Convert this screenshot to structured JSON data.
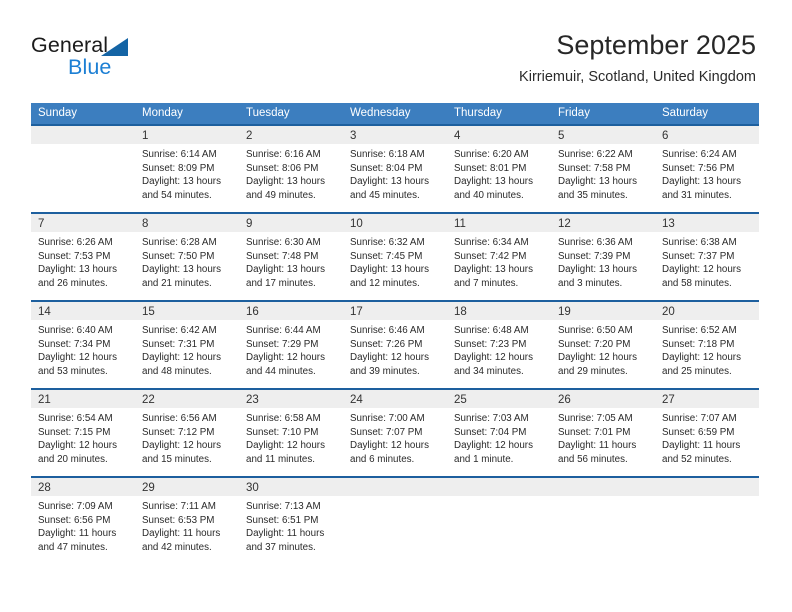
{
  "brand": {
    "name_line1": "General",
    "name_line2": "Blue",
    "triangle_icon": "blue-triangle-logo-mark",
    "color_dark": "#1b1b1b",
    "color_blue": "#1c7fd4",
    "triangle_color": "#1464a5"
  },
  "header": {
    "title": "September 2025",
    "subtitle": "Kirriemuir, Scotland, United Kingdom"
  },
  "theme": {
    "header_row_bg": "#3c7ebf",
    "week_rule": "#1d5f9e",
    "daynum_band_bg": "#eeeeee",
    "text": "#2a2a2a"
  },
  "columns": [
    "Sunday",
    "Monday",
    "Tuesday",
    "Wednesday",
    "Thursday",
    "Friday",
    "Saturday"
  ],
  "labels": {
    "sunrise_prefix": "Sunrise:",
    "sunset_prefix": "Sunset:",
    "daylight_prefix": "Daylight:"
  },
  "weeks": [
    [
      {
        "day": "",
        "empty": true,
        "lines": []
      },
      {
        "day": "1",
        "lines": [
          "Sunrise: 6:14 AM",
          "Sunset: 8:09 PM",
          "Daylight: 13 hours",
          "and 54 minutes."
        ]
      },
      {
        "day": "2",
        "lines": [
          "Sunrise: 6:16 AM",
          "Sunset: 8:06 PM",
          "Daylight: 13 hours",
          "and 49 minutes."
        ]
      },
      {
        "day": "3",
        "lines": [
          "Sunrise: 6:18 AM",
          "Sunset: 8:04 PM",
          "Daylight: 13 hours",
          "and 45 minutes."
        ]
      },
      {
        "day": "4",
        "lines": [
          "Sunrise: 6:20 AM",
          "Sunset: 8:01 PM",
          "Daylight: 13 hours",
          "and 40 minutes."
        ]
      },
      {
        "day": "5",
        "lines": [
          "Sunrise: 6:22 AM",
          "Sunset: 7:58 PM",
          "Daylight: 13 hours",
          "and 35 minutes."
        ]
      },
      {
        "day": "6",
        "lines": [
          "Sunrise: 6:24 AM",
          "Sunset: 7:56 PM",
          "Daylight: 13 hours",
          "and 31 minutes."
        ]
      }
    ],
    [
      {
        "day": "7",
        "lines": [
          "Sunrise: 6:26 AM",
          "Sunset: 7:53 PM",
          "Daylight: 13 hours",
          "and 26 minutes."
        ]
      },
      {
        "day": "8",
        "lines": [
          "Sunrise: 6:28 AM",
          "Sunset: 7:50 PM",
          "Daylight: 13 hours",
          "and 21 minutes."
        ]
      },
      {
        "day": "9",
        "lines": [
          "Sunrise: 6:30 AM",
          "Sunset: 7:48 PM",
          "Daylight: 13 hours",
          "and 17 minutes."
        ]
      },
      {
        "day": "10",
        "lines": [
          "Sunrise: 6:32 AM",
          "Sunset: 7:45 PM",
          "Daylight: 13 hours",
          "and 12 minutes."
        ]
      },
      {
        "day": "11",
        "lines": [
          "Sunrise: 6:34 AM",
          "Sunset: 7:42 PM",
          "Daylight: 13 hours",
          "and 7 minutes."
        ]
      },
      {
        "day": "12",
        "lines": [
          "Sunrise: 6:36 AM",
          "Sunset: 7:39 PM",
          "Daylight: 13 hours",
          "and 3 minutes."
        ]
      },
      {
        "day": "13",
        "lines": [
          "Sunrise: 6:38 AM",
          "Sunset: 7:37 PM",
          "Daylight: 12 hours",
          "and 58 minutes."
        ]
      }
    ],
    [
      {
        "day": "14",
        "lines": [
          "Sunrise: 6:40 AM",
          "Sunset: 7:34 PM",
          "Daylight: 12 hours",
          "and 53 minutes."
        ]
      },
      {
        "day": "15",
        "lines": [
          "Sunrise: 6:42 AM",
          "Sunset: 7:31 PM",
          "Daylight: 12 hours",
          "and 48 minutes."
        ]
      },
      {
        "day": "16",
        "lines": [
          "Sunrise: 6:44 AM",
          "Sunset: 7:29 PM",
          "Daylight: 12 hours",
          "and 44 minutes."
        ]
      },
      {
        "day": "17",
        "lines": [
          "Sunrise: 6:46 AM",
          "Sunset: 7:26 PM",
          "Daylight: 12 hours",
          "and 39 minutes."
        ]
      },
      {
        "day": "18",
        "lines": [
          "Sunrise: 6:48 AM",
          "Sunset: 7:23 PM",
          "Daylight: 12 hours",
          "and 34 minutes."
        ]
      },
      {
        "day": "19",
        "lines": [
          "Sunrise: 6:50 AM",
          "Sunset: 7:20 PM",
          "Daylight: 12 hours",
          "and 29 minutes."
        ]
      },
      {
        "day": "20",
        "lines": [
          "Sunrise: 6:52 AM",
          "Sunset: 7:18 PM",
          "Daylight: 12 hours",
          "and 25 minutes."
        ]
      }
    ],
    [
      {
        "day": "21",
        "lines": [
          "Sunrise: 6:54 AM",
          "Sunset: 7:15 PM",
          "Daylight: 12 hours",
          "and 20 minutes."
        ]
      },
      {
        "day": "22",
        "lines": [
          "Sunrise: 6:56 AM",
          "Sunset: 7:12 PM",
          "Daylight: 12 hours",
          "and 15 minutes."
        ]
      },
      {
        "day": "23",
        "lines": [
          "Sunrise: 6:58 AM",
          "Sunset: 7:10 PM",
          "Daylight: 12 hours",
          "and 11 minutes."
        ]
      },
      {
        "day": "24",
        "lines": [
          "Sunrise: 7:00 AM",
          "Sunset: 7:07 PM",
          "Daylight: 12 hours",
          "and 6 minutes."
        ]
      },
      {
        "day": "25",
        "lines": [
          "Sunrise: 7:03 AM",
          "Sunset: 7:04 PM",
          "Daylight: 12 hours",
          "and 1 minute."
        ]
      },
      {
        "day": "26",
        "lines": [
          "Sunrise: 7:05 AM",
          "Sunset: 7:01 PM",
          "Daylight: 11 hours",
          "and 56 minutes."
        ]
      },
      {
        "day": "27",
        "lines": [
          "Sunrise: 7:07 AM",
          "Sunset: 6:59 PM",
          "Daylight: 11 hours",
          "and 52 minutes."
        ]
      }
    ],
    [
      {
        "day": "28",
        "lines": [
          "Sunrise: 7:09 AM",
          "Sunset: 6:56 PM",
          "Daylight: 11 hours",
          "and 47 minutes."
        ]
      },
      {
        "day": "29",
        "lines": [
          "Sunrise: 7:11 AM",
          "Sunset: 6:53 PM",
          "Daylight: 11 hours",
          "and 42 minutes."
        ]
      },
      {
        "day": "30",
        "lines": [
          "Sunrise: 7:13 AM",
          "Sunset: 6:51 PM",
          "Daylight: 11 hours",
          "and 37 minutes."
        ]
      },
      {
        "day": "",
        "empty": true,
        "lines": []
      },
      {
        "day": "",
        "empty": true,
        "lines": []
      },
      {
        "day": "",
        "empty": true,
        "lines": []
      },
      {
        "day": "",
        "empty": true,
        "lines": []
      }
    ]
  ]
}
